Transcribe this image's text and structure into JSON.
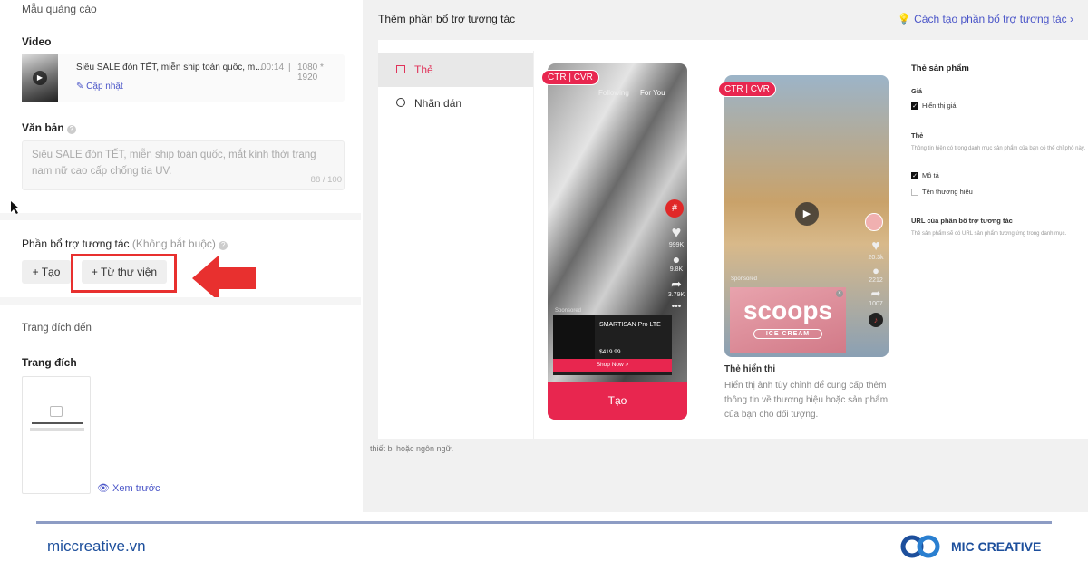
{
  "left": {
    "ad_template": "Mẫu quảng cáo",
    "video_label": "Video",
    "video_title": "Siêu SALE đón TẾT, miễn ship toàn quốc, m...",
    "video_duration": "00:14",
    "video_size": "1080 * 1920",
    "update_link": "Cập nhật",
    "text_label": "Văn bản",
    "text_value": "Siêu SALE đón TẾT, miễn ship toàn quốc, mắt kính thời trang nam nữ cao cấp chống tia UV.",
    "text_count": "88 / 100",
    "interactive_label": "Phần bổ trợ tương tác",
    "interactive_optional": "(Không bắt buộc)",
    "create_button": "+ Tạo",
    "library_button": "+ Từ thư viện",
    "destination_section": "Trang đích đến",
    "destination_label": "Trang đích",
    "preview_link": "Xem trước",
    "highlight_color": "#e8302f"
  },
  "right": {
    "title": "Thêm phần bổ trợ tương tác",
    "help_link": "Cách tạo phần bổ trợ tương tác",
    "tabs": [
      {
        "label": "Thẻ",
        "icon": "card-icon",
        "selected": true
      },
      {
        "label": "Nhãn dán",
        "icon": "sticker-icon",
        "selected": false
      }
    ],
    "phone1": {
      "badge": "CTR | CVR",
      "following": "Following",
      "for_you": "For You",
      "likes": "999K",
      "comments": "9.8K",
      "shares": "3.79K",
      "sponsored": "Sponsored",
      "product": "SMARTISAN Pro LTE",
      "price": "$419.99",
      "shop_now": "Shop Now >",
      "create_button": "Tạo"
    },
    "phone2": {
      "badge": "CTR | CVR",
      "likes": "20.3k",
      "comments": "2212",
      "shares": "1007",
      "sponsored": "Sponsored",
      "brand": "scoops",
      "brand_sub": "ICE CREAM"
    },
    "card_title": "Thẻ hiển thị",
    "card_desc": "Hiển thị ảnh tùy chỉnh để cung cấp thêm thông tin về thương hiệu hoặc sản phẩm của bạn cho đối tượng.",
    "bottom_note": "thiết bị hoặc ngôn ngữ.",
    "settings": {
      "title": "Thẻ sản phẩm",
      "price_label": "Giá",
      "show_price": "Hiển thị giá",
      "card_label": "Thẻ",
      "card_note": "Thông tin hiện có trong danh mục sản phẩm của bạn có thể chỉ phô này.",
      "desc_option": "Mô tả",
      "brand_option": "Tên thương hiệu",
      "url_label": "URL của phần bổ trợ tương tác",
      "url_note": "Thẻ sản phẩm sẽ có URL sản phẩm tương ứng trong danh mục."
    },
    "accent": "#e8264f"
  },
  "footer": {
    "site": "miccreative.vn",
    "brand": "MIC CREATIVE",
    "color": "#1d4f9c"
  }
}
